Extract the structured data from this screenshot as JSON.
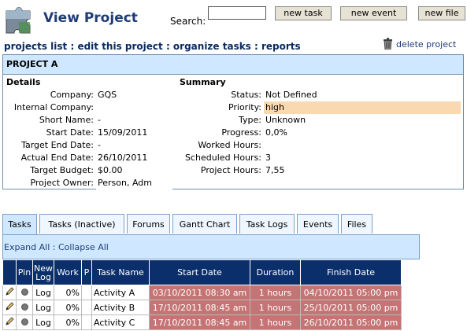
{
  "header": {
    "title": "View Project",
    "search_label": "Search:",
    "search_value": "",
    "buttons": {
      "new_task": "new task",
      "new_event": "new event",
      "new_file": "new file"
    }
  },
  "nav": {
    "projects_list": "projects list",
    "edit_project": "edit this project",
    "organize_tasks": "organize tasks",
    "reports": "reports",
    "separator": " : ",
    "delete_project": "delete project"
  },
  "project": {
    "name": "PROJECT A",
    "details_heading": "Details",
    "summary_heading": "Summary",
    "details": [
      {
        "label": "Company:",
        "value": "GQS"
      },
      {
        "label": "Internal Company:",
        "value": ""
      },
      {
        "label": "Short Name:",
        "value": "-"
      },
      {
        "label": "Start Date:",
        "value": "15/09/2011"
      },
      {
        "label": "Target End Date:",
        "value": "-"
      },
      {
        "label": "Actual End Date:",
        "value": "26/10/2011"
      },
      {
        "label": "Target Budget:",
        "value": "$0.00"
      },
      {
        "label": "Project Owner:",
        "value": "Person, Adm"
      }
    ],
    "summary": [
      {
        "label": "Status:",
        "value": "Not Defined"
      },
      {
        "label": "Priority:",
        "value": "high"
      },
      {
        "label": "Type:",
        "value": "Unknown"
      },
      {
        "label": "Progress:",
        "value": "0,0%"
      },
      {
        "label": "Worked Hours:",
        "value": ""
      },
      {
        "label": "Scheduled Hours:",
        "value": "3"
      },
      {
        "label": "Project Hours:",
        "value": "7,55"
      }
    ],
    "priority_color": "#fbd9b0"
  },
  "tabs": [
    "Tasks",
    "Tasks (Inactive)",
    "Forums",
    "Gantt Chart",
    "Task Logs",
    "Events",
    "Files"
  ],
  "expand": {
    "expand_all": "Expand All",
    "sep": " : ",
    "collapse_all": "Collapse All"
  },
  "table": {
    "headers": [
      "",
      "Pin",
      "New Log",
      "Work",
      "P",
      "Task Name",
      "Start Date",
      "Duration",
      "Finish Date"
    ],
    "rows": [
      {
        "log": "Log",
        "work": "0%",
        "name": "Activity A",
        "start": "03/10/2011 08:30 am",
        "duration": "1 hours",
        "finish": "04/10/2011 05:00 pm"
      },
      {
        "log": "Log",
        "work": "0%",
        "name": "Activity B",
        "start": "17/10/2011 08:45 am",
        "duration": "1 hours",
        "finish": "25/10/2011 05:00 pm"
      },
      {
        "log": "Log",
        "work": "0%",
        "name": "Activity C",
        "start": "17/10/2011 08:45 am",
        "duration": "1 hours",
        "finish": "26/10/2011 05:00 pm"
      }
    ],
    "late_color": "#c47474",
    "header_color": "#0b2f6a"
  }
}
